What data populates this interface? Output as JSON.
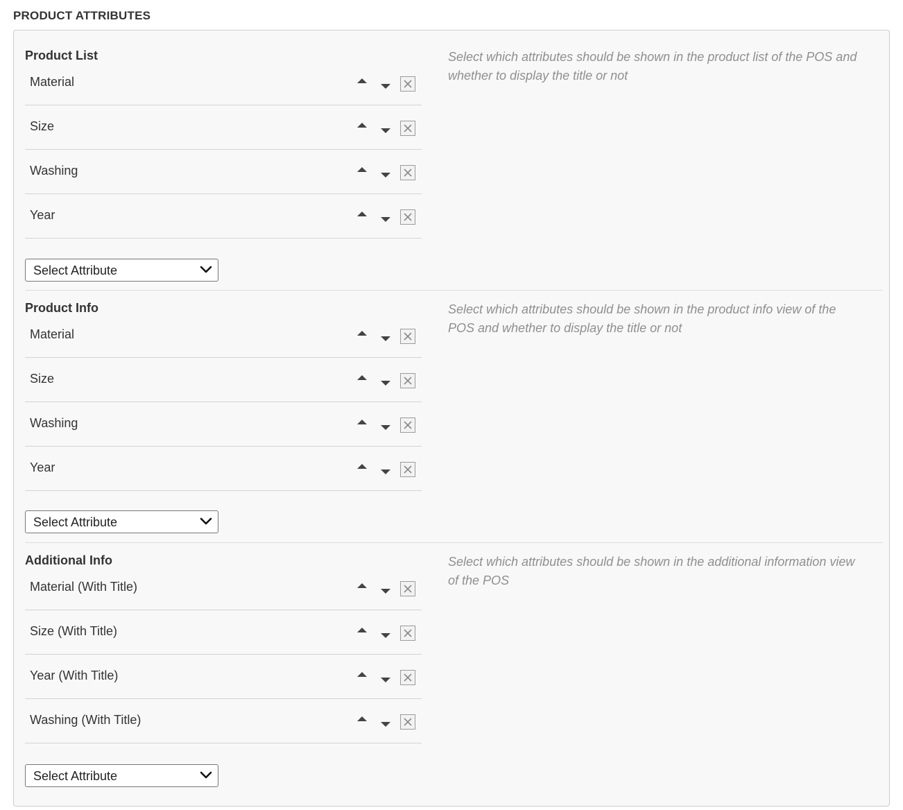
{
  "page": {
    "heading": "PRODUCT ATTRIBUTES"
  },
  "sections": [
    {
      "title": "Product List",
      "help": "Select which attributes should be shown in the product list of the POS and whether to display the title or not",
      "items": [
        {
          "label": "Material"
        },
        {
          "label": "Size"
        },
        {
          "label": "Washing"
        },
        {
          "label": "Year"
        }
      ],
      "select": {
        "selected": "Select Attribute"
      }
    },
    {
      "title": "Product Info",
      "help": "Select which attributes should be shown in the product info view of the POS and whether to display the title or not",
      "items": [
        {
          "label": "Material"
        },
        {
          "label": "Size"
        },
        {
          "label": "Washing"
        },
        {
          "label": "Year"
        }
      ],
      "select": {
        "selected": "Select Attribute"
      }
    },
    {
      "title": "Additional Info",
      "help": "Select which attributes should be shown in the additional information view of the POS",
      "items": [
        {
          "label": "Material (With Title)"
        },
        {
          "label": "Size (With Title)"
        },
        {
          "label": "Year (With Title)"
        },
        {
          "label": "Washing (With Title)"
        }
      ],
      "select": {
        "selected": "Select Attribute"
      }
    }
  ],
  "icons": {
    "move_up": "caret-up-icon",
    "move_down": "caret-down-icon",
    "remove": "close-box-icon",
    "dropdown": "chevron-down-icon"
  },
  "colors": {
    "panel_background": "#f8f8f8",
    "panel_border": "#cccccc",
    "help_text": "#8f8f8f",
    "row_divider": "#d3d3d3"
  }
}
